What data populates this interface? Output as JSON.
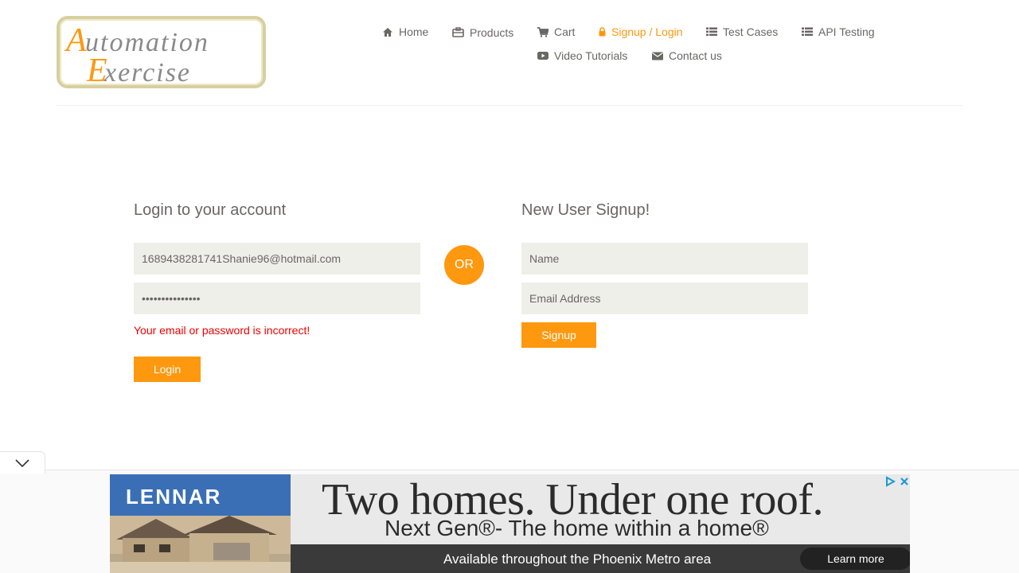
{
  "header": {
    "logo_text_line1": "Automation",
    "logo_text_line2": "Exercise",
    "nav": [
      {
        "label": "Home",
        "icon": "home-icon"
      },
      {
        "label": "Products",
        "icon": "briefcase-icon"
      },
      {
        "label": "Cart",
        "icon": "cart-icon"
      },
      {
        "label": "Signup / Login",
        "icon": "lock-icon",
        "active": true
      },
      {
        "label": "Test Cases",
        "icon": "list-icon"
      },
      {
        "label": "API Testing",
        "icon": "list-icon"
      },
      {
        "label": "Video Tutorials",
        "icon": "youtube-play-icon"
      },
      {
        "label": "Contact us",
        "icon": "envelope-icon"
      }
    ]
  },
  "login": {
    "title": "Login to your account",
    "email_value": "1689438281741Shanie96@hotmail.com",
    "password_value": "•••••••••••••••",
    "error": "Your email or password is incorrect!",
    "button": "Login"
  },
  "or_label": "OR",
  "signup": {
    "title": "New User Signup!",
    "name_placeholder": "Name",
    "email_placeholder": "Email Address",
    "button": "Signup"
  },
  "ad": {
    "brand": "LENNAR",
    "headline": "Two homes. Under one roof.",
    "subline": "Next Gen®- The home within a home®",
    "footer": "Available throughout the Phoenix Metro area",
    "cta": "Learn more"
  },
  "colors": {
    "accent": "#fe980f",
    "text": "#696763",
    "error": "#ee0000",
    "input_bg": "#efefea"
  }
}
